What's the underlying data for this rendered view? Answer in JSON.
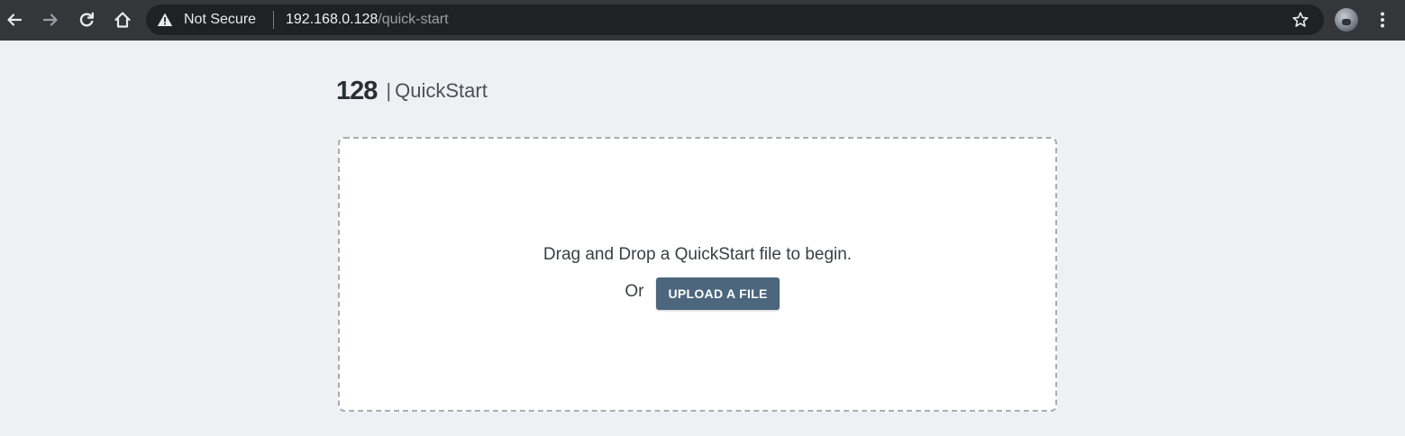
{
  "browser": {
    "security_label": "Not Secure",
    "url_host": "192.168.0.128",
    "url_path": "/quick-start",
    "icons": {
      "back": "back-arrow-icon",
      "forward": "forward-arrow-icon",
      "reload": "reload-icon",
      "home": "home-icon",
      "warning": "warning-triangle-icon",
      "bookmark": "star-icon",
      "profile": "avatar",
      "menu": "kebab-menu-icon"
    },
    "colors": {
      "toolbar": "#35363a",
      "omnibox": "#202124"
    }
  },
  "page": {
    "brand": "128",
    "separator": "|",
    "title": "QuickStart",
    "background": "#eff0f4"
  },
  "dropzone": {
    "prompt": "Drag and Drop a QuickStart file to begin.",
    "or_label": "Or",
    "upload_label": "UPLOAD A FILE",
    "button_color": "#4b667d"
  }
}
